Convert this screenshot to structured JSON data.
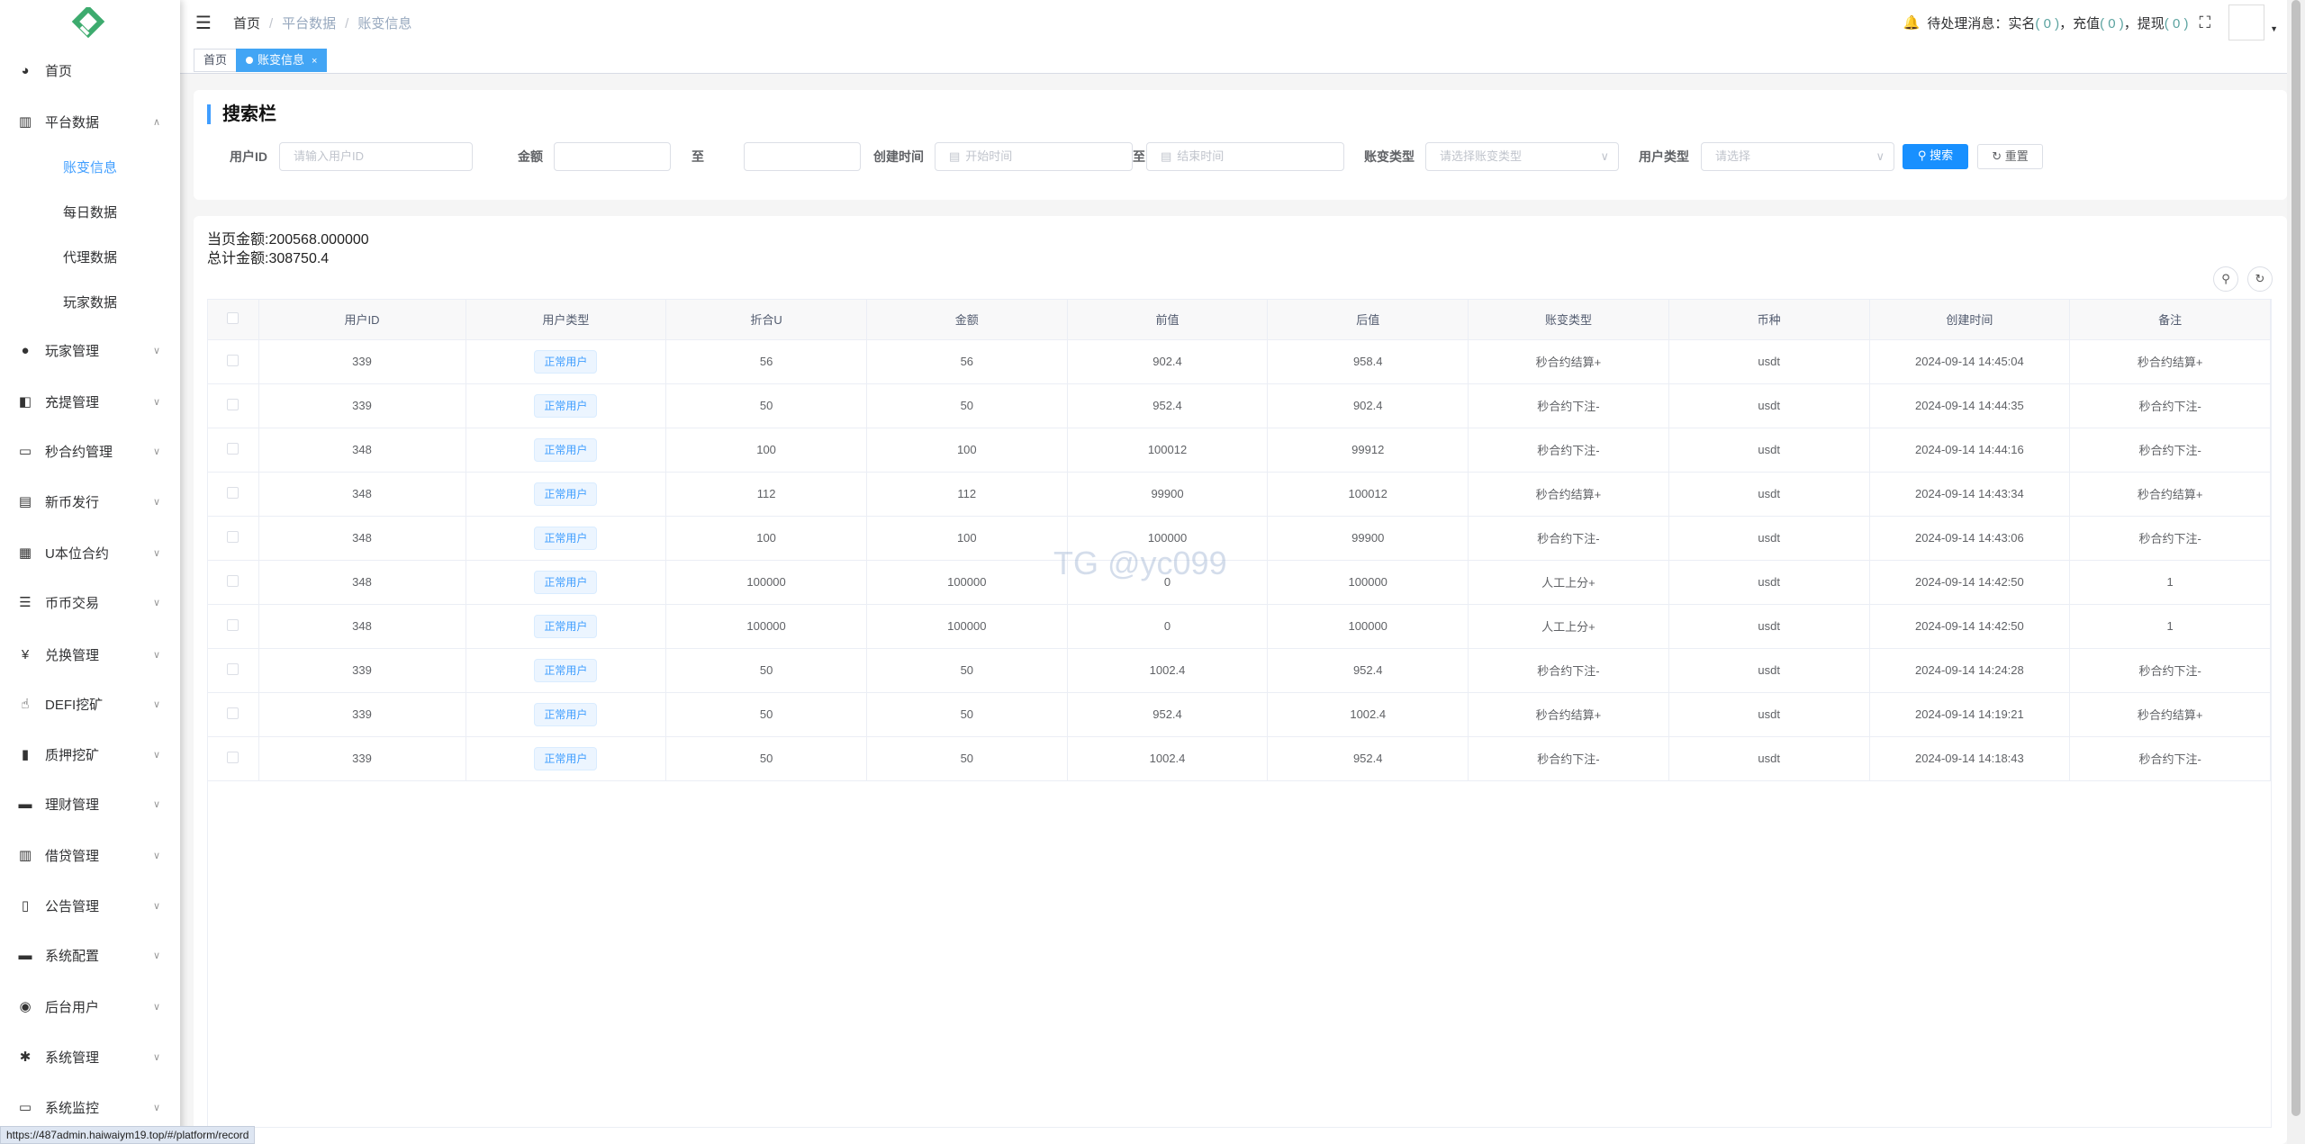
{
  "sidebar": {
    "items": [
      {
        "label": "首页",
        "icon": "dashboard-icon"
      },
      {
        "label": "平台数据",
        "icon": "excel-icon",
        "expanded": true,
        "children": [
          "账变信息",
          "每日数据",
          "代理数据",
          "玩家数据"
        ]
      },
      {
        "label": "玩家管理",
        "icon": "user-icon"
      },
      {
        "label": "充提管理",
        "icon": "wallet-icon"
      },
      {
        "label": "秒合约管理",
        "icon": "monitor-icon"
      },
      {
        "label": "新币发行",
        "icon": "calendar-icon"
      },
      {
        "label": "U本位合约",
        "icon": "table-icon"
      },
      {
        "label": "币币交易",
        "icon": "list-icon"
      },
      {
        "label": "兑换管理",
        "icon": "yen-icon"
      },
      {
        "label": "DEFI挖矿",
        "icon": "pointer-icon"
      },
      {
        "label": "质押挖矿",
        "icon": "bar-chart-icon"
      },
      {
        "label": "理财管理",
        "icon": "form-icon"
      },
      {
        "label": "借贷管理",
        "icon": "excel-icon"
      },
      {
        "label": "公告管理",
        "icon": "book-icon"
      },
      {
        "label": "系统配置",
        "icon": "form-icon"
      },
      {
        "label": "后台用户",
        "icon": "peoples-icon"
      },
      {
        "label": "系统管理",
        "icon": "gear-icon"
      },
      {
        "label": "系统监控",
        "icon": "monitor-icon"
      }
    ]
  },
  "header": {
    "breadcrumb": [
      "首页",
      "平台数据",
      "账变信息"
    ],
    "pending_label": "待处理消息：",
    "realname": "实名",
    "realname_count": "( 0 )",
    "recharge": "，充值",
    "recharge_count": "( 0 )",
    "withdraw": "，提现",
    "withdraw_count": "( 0 )"
  },
  "tabs": [
    {
      "label": "首页"
    },
    {
      "label": "账变信息"
    }
  ],
  "search": {
    "title": "搜索栏",
    "user_id_label": "用户ID",
    "user_id_placeholder": "请输入用户ID",
    "amount_label": "金额",
    "to1": "至",
    "time_label": "创建时间",
    "start_placeholder": "开始时间",
    "to2": "至",
    "end_placeholder": "结束时间",
    "type_label": "账变类型",
    "type_placeholder": "请选择账变类型",
    "user_type_label": "用户类型",
    "user_type_placeholder": "请选择",
    "search_btn": "搜索",
    "reset_btn": "重置"
  },
  "summary": {
    "page_amount": "当页金额:200568.000000",
    "total_amount": "总计金额:308750.4"
  },
  "table": {
    "columns": [
      "用户ID",
      "用户类型",
      "折合U",
      "金额",
      "前值",
      "后值",
      "账变类型",
      "币种",
      "创建时间",
      "备注"
    ],
    "rows": [
      [
        "339",
        "正常用户",
        "56",
        "56",
        "902.4",
        "958.4",
        "秒合约结算+",
        "usdt",
        "2024-09-14 14:45:04",
        "秒合约结算+"
      ],
      [
        "339",
        "正常用户",
        "50",
        "50",
        "952.4",
        "902.4",
        "秒合约下注-",
        "usdt",
        "2024-09-14 14:44:35",
        "秒合约下注-"
      ],
      [
        "348",
        "正常用户",
        "100",
        "100",
        "100012",
        "99912",
        "秒合约下注-",
        "usdt",
        "2024-09-14 14:44:16",
        "秒合约下注-"
      ],
      [
        "348",
        "正常用户",
        "112",
        "112",
        "99900",
        "100012",
        "秒合约结算+",
        "usdt",
        "2024-09-14 14:43:34",
        "秒合约结算+"
      ],
      [
        "348",
        "正常用户",
        "100",
        "100",
        "100000",
        "99900",
        "秒合约下注-",
        "usdt",
        "2024-09-14 14:43:06",
        "秒合约下注-"
      ],
      [
        "348",
        "正常用户",
        "100000",
        "100000",
        "0",
        "100000",
        "人工上分+",
        "usdt",
        "2024-09-14 14:42:50",
        "1"
      ],
      [
        "348",
        "正常用户",
        "100000",
        "100000",
        "0",
        "100000",
        "人工上分+",
        "usdt",
        "2024-09-14 14:42:50",
        "1"
      ],
      [
        "339",
        "正常用户",
        "50",
        "50",
        "1002.4",
        "952.4",
        "秒合约下注-",
        "usdt",
        "2024-09-14 14:24:28",
        "秒合约下注-"
      ],
      [
        "339",
        "正常用户",
        "50",
        "50",
        "952.4",
        "1002.4",
        "秒合约结算+",
        "usdt",
        "2024-09-14 14:19:21",
        "秒合约结算+"
      ],
      [
        "339",
        "正常用户",
        "50",
        "50",
        "1002.4",
        "952.4",
        "秒合约下注-",
        "usdt",
        "2024-09-14 14:18:43",
        "秒合约下注-"
      ]
    ]
  },
  "watermark": "TG @yc099",
  "status_url": "https://487admin.haiwaiym19.top/#/platform/record"
}
